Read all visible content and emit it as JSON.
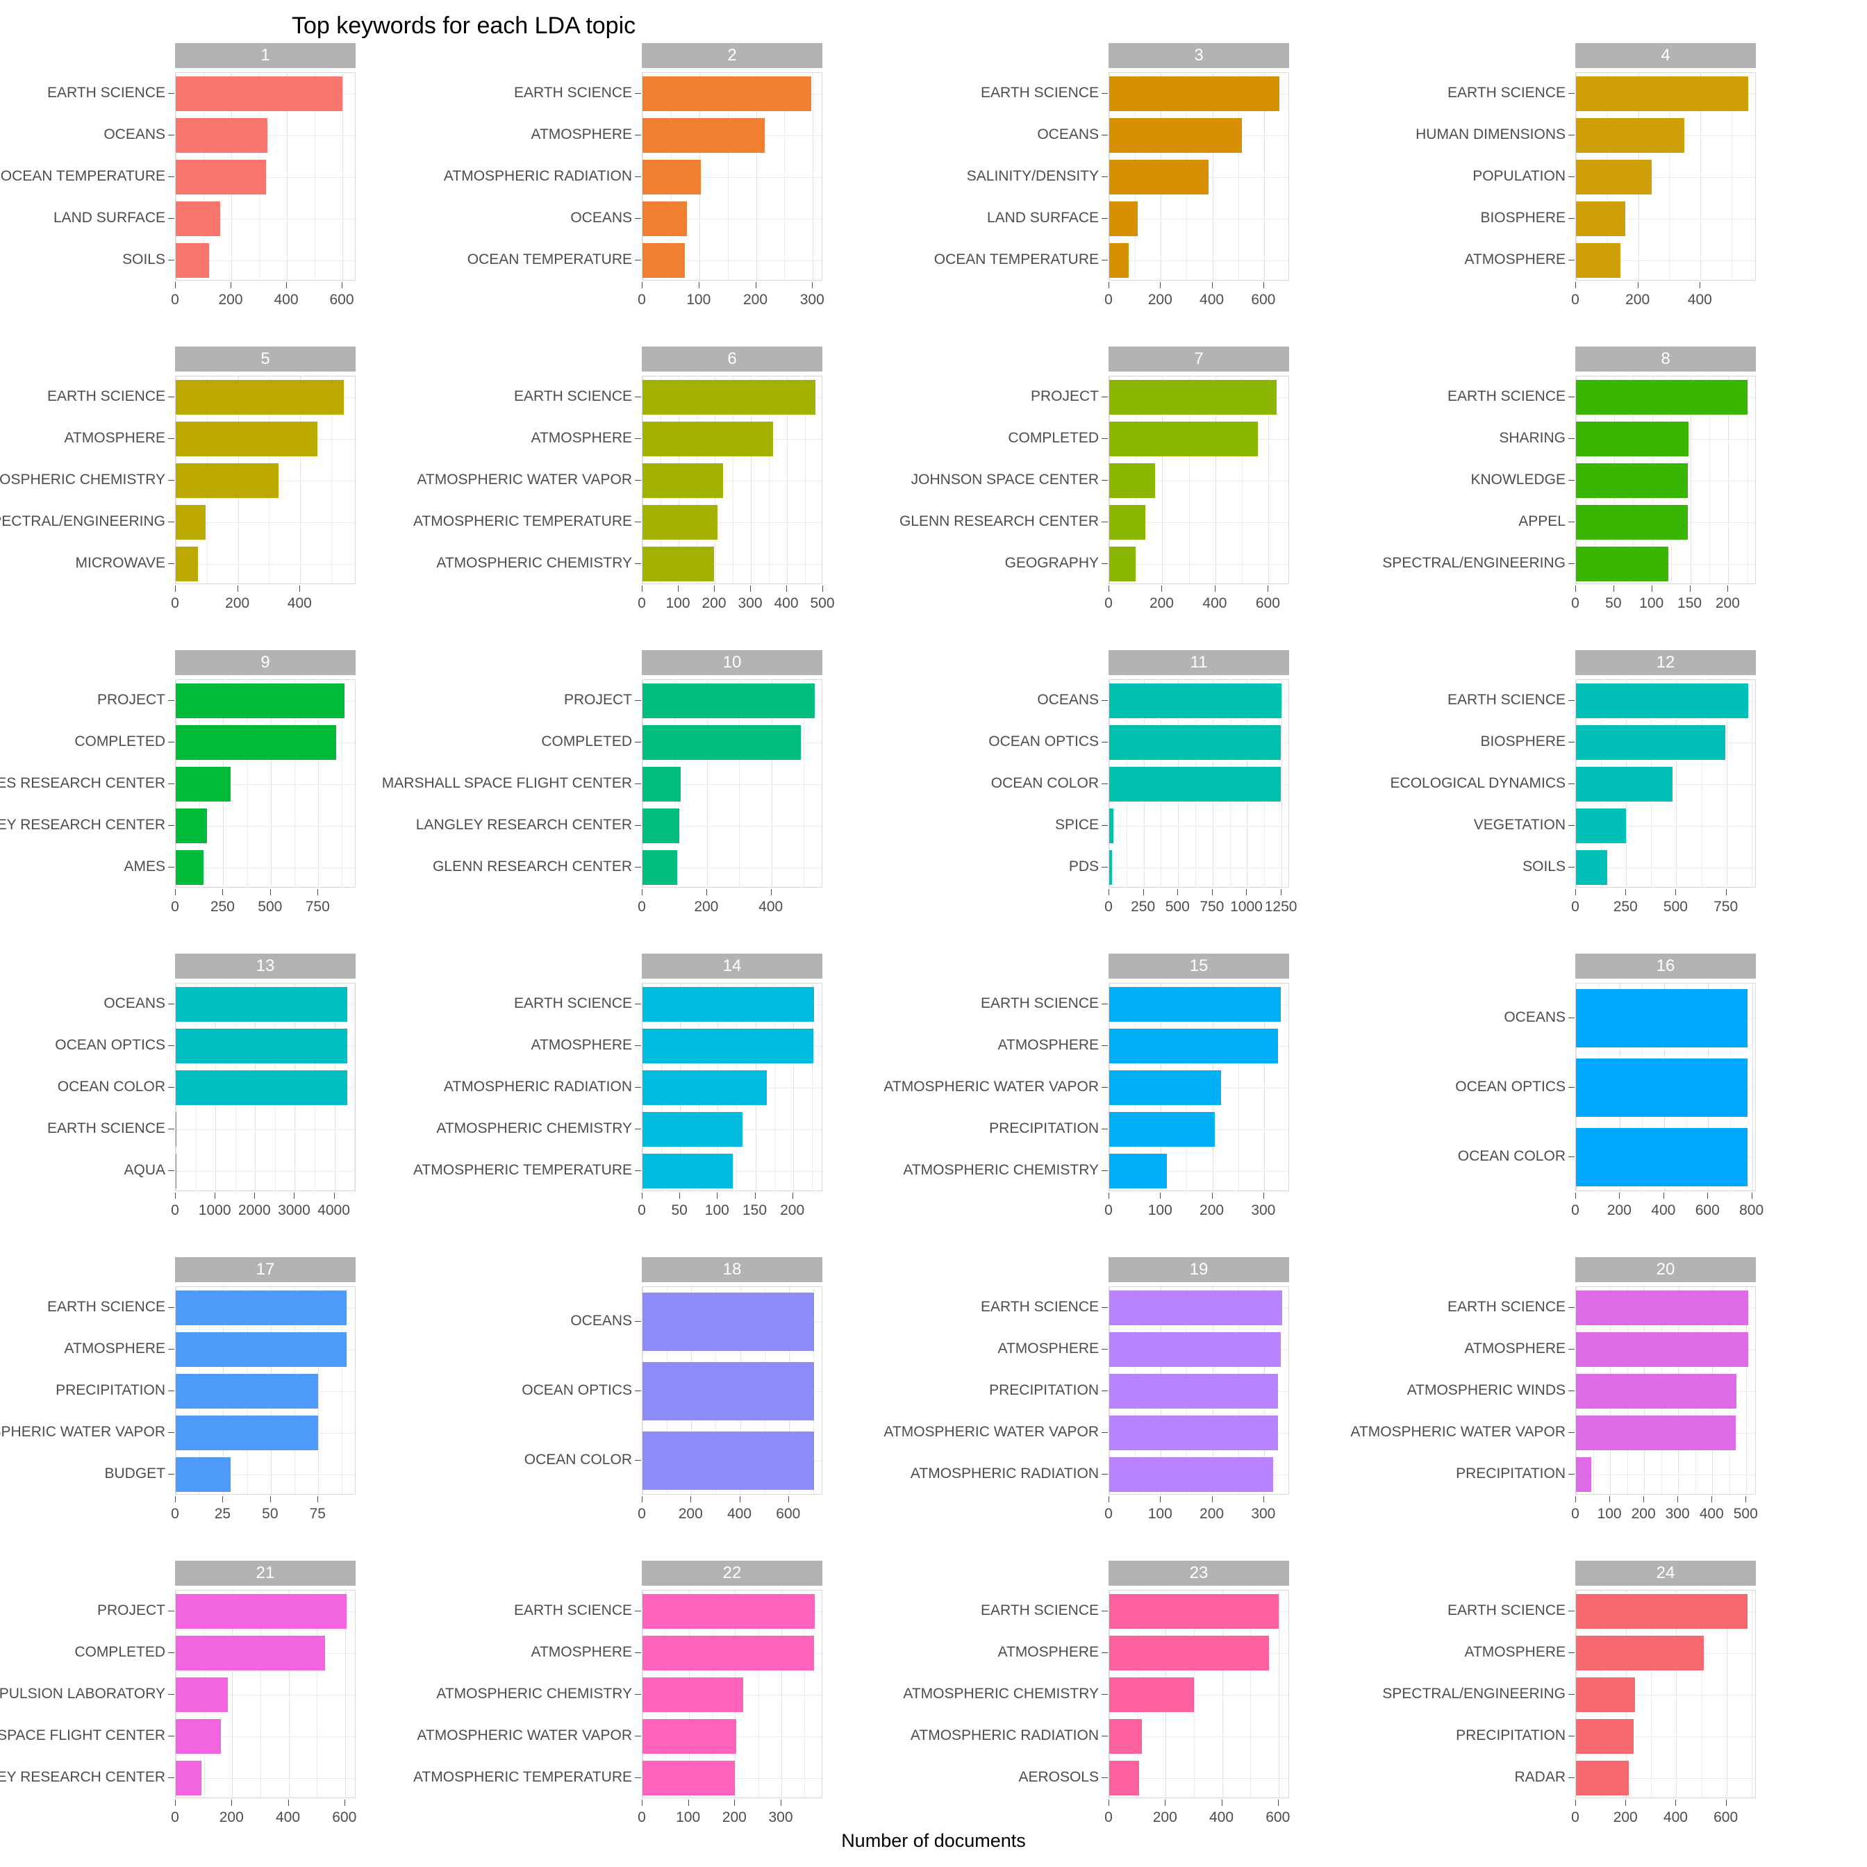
{
  "chart_data": {
    "type": "bar",
    "title": "Top keywords for each LDA topic",
    "xlabel": "Number of documents",
    "ylabel": "",
    "orientation": "horizontal",
    "facet_label_prefix": "",
    "grid": true,
    "legend": "none",
    "strip_background": "#b3b3b3",
    "strip_text_color": "#ffffff",
    "panel_background": "#ffffff",
    "gridline_color": "#ebebeb",
    "panels": [
      {
        "facet": "1",
        "color": "#f8766d",
        "xlim": [
          0,
          650
        ],
        "xticks": [
          0,
          200,
          400,
          600
        ],
        "categories": [
          "EARTH SCIENCE",
          "OCEANS",
          "OCEAN TEMPERATURE",
          "LAND SURFACE",
          "SOILS"
        ],
        "values": [
          600,
          330,
          325,
          160,
          120
        ]
      },
      {
        "facet": "2",
        "color": "#ef7f31",
        "xlim": [
          0,
          318
        ],
        "xticks": [
          0,
          100,
          200,
          300
        ],
        "categories": [
          "EARTH SCIENCE",
          "ATMOSPHERE",
          "ATMOSPHERIC RADIATION",
          "OCEANS",
          "OCEAN TEMPERATURE"
        ],
        "values": [
          297,
          215,
          103,
          78,
          75
        ]
      },
      {
        "facet": "3",
        "color": "#d89000",
        "xlim": [
          0,
          700
        ],
        "xticks": [
          0,
          200,
          400,
          600
        ],
        "categories": [
          "EARTH SCIENCE",
          "OCEANS",
          "SALINITY/DENSITY",
          "LAND SURFACE",
          "OCEAN TEMPERATURE"
        ],
        "values": [
          660,
          515,
          385,
          110,
          75
        ]
      },
      {
        "facet": "4",
        "color": "#cfa006",
        "xlim": [
          0,
          580
        ],
        "xticks": [
          0,
          200,
          400
        ],
        "categories": [
          "EARTH SCIENCE",
          "HUMAN DIMENSIONS",
          "POPULATION",
          "BIOSPHERE",
          "ATMOSPHERE"
        ],
        "values": [
          553,
          348,
          243,
          158,
          143
        ]
      },
      {
        "facet": "5",
        "color": "#bba900",
        "xlim": [
          0,
          580
        ],
        "xticks": [
          0,
          200,
          400
        ],
        "categories": [
          "EARTH SCIENCE",
          "ATMOSPHERE",
          "ATMOSPHERIC CHEMISTRY",
          "SPECTRAL/ENGINEERING",
          "MICROWAVE"
        ],
        "values": [
          540,
          455,
          330,
          95,
          72
        ]
      },
      {
        "facet": "6",
        "color": "#a3b100",
        "xlim": [
          0,
          500
        ],
        "xticks": [
          0,
          100,
          200,
          300,
          400,
          500
        ],
        "categories": [
          "EARTH SCIENCE",
          "ATMOSPHERE",
          "ATMOSPHERIC WATER VAPOR",
          "ATMOSPHERIC TEMPERATURE",
          "ATMOSPHERIC CHEMISTRY"
        ],
        "values": [
          478,
          362,
          224,
          208,
          198
        ]
      },
      {
        "facet": "7",
        "color": "#8cb700",
        "xlim": [
          0,
          680
        ],
        "xticks": [
          0,
          200,
          400,
          600
        ],
        "categories": [
          "PROJECT",
          "COMPLETED",
          "JOHNSON SPACE CENTER",
          "GLENN RESEARCH CENTER",
          "GEOGRAPHY"
        ],
        "values": [
          631,
          560,
          172,
          135,
          100
        ]
      },
      {
        "facet": "8",
        "color": "#39b600",
        "xlim": [
          0,
          237
        ],
        "xticks": [
          0,
          50,
          100,
          150,
          200
        ],
        "categories": [
          "EARTH SCIENCE",
          "SHARING",
          "KNOWLEDGE",
          "APPEL",
          "SPECTRAL/ENGINEERING"
        ],
        "values": [
          225,
          148,
          147,
          147,
          121
        ]
      },
      {
        "facet": "9",
        "color": "#00bb38",
        "xlim": [
          0,
          950
        ],
        "xticks": [
          0,
          250,
          500,
          750
        ],
        "categories": [
          "PROJECT",
          "COMPLETED",
          "AMES RESEARCH CENTER",
          "LANGLEY RESEARCH CENTER",
          "AMES"
        ],
        "values": [
          888,
          845,
          290,
          165,
          145
        ]
      },
      {
        "facet": "10",
        "color": "#00bf7d",
        "xlim": [
          0,
          560
        ],
        "xticks": [
          0,
          200,
          400
        ],
        "categories": [
          "PROJECT",
          "COMPLETED",
          "MARSHALL SPACE FLIGHT CENTER",
          "LANGLEY RESEARCH CENTER",
          "GLENN RESEARCH CENTER"
        ],
        "values": [
          535,
          490,
          118,
          115,
          108
        ]
      },
      {
        "facet": "11",
        "color": "#00c0af",
        "xlim": [
          0,
          1310
        ],
        "xticks": [
          0,
          250,
          500,
          750,
          1000,
          1250
        ],
        "categories": [
          "OCEANS",
          "OCEAN OPTICS",
          "OCEAN COLOR",
          "SPICE",
          "PDS"
        ],
        "values": [
          1248,
          1246,
          1244,
          30,
          22
        ]
      },
      {
        "facet": "12",
        "color": "#00c0b8",
        "xlim": [
          0,
          900
        ],
        "xticks": [
          0,
          250,
          500,
          750
        ],
        "categories": [
          "EARTH SCIENCE",
          "BIOSPHERE",
          "ECOLOGICAL DYNAMICS",
          "VEGETATION",
          "SOILS"
        ],
        "values": [
          858,
          745,
          480,
          250,
          155
        ]
      },
      {
        "facet": "13",
        "color": "#00bfc4",
        "xlim": [
          0,
          4550
        ],
        "xticks": [
          0,
          1000,
          2000,
          3000,
          4000
        ],
        "categories": [
          "OCEANS",
          "OCEAN OPTICS",
          "OCEAN COLOR",
          "EARTH SCIENCE",
          "AQUA"
        ],
        "values": [
          4320,
          4320,
          4320,
          4,
          3
        ]
      },
      {
        "facet": "14",
        "color": "#00bde0",
        "xlim": [
          0,
          240
        ],
        "xticks": [
          0,
          50,
          100,
          150,
          200
        ],
        "categories": [
          "EARTH SCIENCE",
          "ATMOSPHERE",
          "ATMOSPHERIC RADIATION",
          "ATMOSPHERIC CHEMISTRY",
          "ATMOSPHERIC TEMPERATURE"
        ],
        "values": [
          228,
          227,
          165,
          133,
          120
        ]
      },
      {
        "facet": "15",
        "color": "#00b0f6",
        "xlim": [
          0,
          350
        ],
        "xticks": [
          0,
          100,
          200,
          300
        ],
        "categories": [
          "EARTH SCIENCE",
          "ATMOSPHERE",
          "ATMOSPHERIC WATER VAPOR",
          "PRECIPITATION",
          "ATMOSPHERIC CHEMISTRY"
        ],
        "values": [
          332,
          327,
          217,
          205,
          112
        ]
      },
      {
        "facet": "16",
        "color": "#00a9ff",
        "xlim": [
          0,
          820
        ],
        "xticks": [
          0,
          200,
          400,
          600,
          800
        ],
        "categories": [
          "OCEANS",
          "OCEAN OPTICS",
          "OCEAN COLOR"
        ],
        "values": [
          780,
          780,
          780
        ]
      },
      {
        "facet": "17",
        "color": "#4f9bfb",
        "xlim": [
          0,
          95
        ],
        "xticks": [
          0,
          25,
          50,
          75
        ],
        "categories": [
          "EARTH SCIENCE",
          "ATMOSPHERE",
          "PRECIPITATION",
          "ATMOSPHERIC WATER VAPOR",
          "BUDGET"
        ],
        "values": [
          90,
          90,
          75,
          75,
          29
        ]
      },
      {
        "facet": "18",
        "color": "#8b8bf9",
        "xlim": [
          0,
          740
        ],
        "xticks": [
          0,
          200,
          400,
          600
        ],
        "categories": [
          "OCEANS",
          "OCEAN OPTICS",
          "OCEAN COLOR"
        ],
        "values": [
          702,
          702,
          702
        ]
      },
      {
        "facet": "19",
        "color": "#b983ff",
        "xlim": [
          0,
          350
        ],
        "xticks": [
          0,
          100,
          200,
          300
        ],
        "categories": [
          "EARTH SCIENCE",
          "ATMOSPHERE",
          "PRECIPITATION",
          "ATMOSPHERIC WATER VAPOR",
          "ATMOSPHERIC RADIATION"
        ],
        "values": [
          335,
          332,
          327,
          327,
          318
        ]
      },
      {
        "facet": "20",
        "color": "#de6ae8",
        "xlim": [
          0,
          530
        ],
        "xticks": [
          0,
          100,
          200,
          300,
          400,
          500
        ],
        "categories": [
          "EARTH SCIENCE",
          "ATMOSPHERE",
          "ATMOSPHERIC WINDS",
          "ATMOSPHERIC WATER VAPOR",
          "PRECIPITATION"
        ],
        "values": [
          505,
          505,
          470,
          468,
          45
        ]
      },
      {
        "facet": "21",
        "color": "#f365e0",
        "xlim": [
          0,
          640
        ],
        "xticks": [
          0,
          200,
          400,
          600
        ],
        "categories": [
          "PROJECT",
          "COMPLETED",
          "JET PROPULSION LABORATORY",
          "GODDARD SPACE FLIGHT CENTER",
          "LANGLEY RESEARCH CENTER"
        ],
        "values": [
          605,
          530,
          185,
          160,
          90
        ]
      },
      {
        "facet": "22",
        "color": "#ff62bc",
        "xlim": [
          0,
          390
        ],
        "xticks": [
          0,
          100,
          200,
          300
        ],
        "categories": [
          "EARTH SCIENCE",
          "ATMOSPHERE",
          "ATMOSPHERIC CHEMISTRY",
          "ATMOSPHERIC WATER VAPOR",
          "ATMOSPHERIC TEMPERATURE"
        ],
        "values": [
          372,
          370,
          218,
          203,
          200
        ]
      },
      {
        "facet": "23",
        "color": "#fd61a0",
        "xlim": [
          0,
          640
        ],
        "xticks": [
          0,
          200,
          400,
          600
        ],
        "categories": [
          "EARTH SCIENCE",
          "ATMOSPHERE",
          "ATMOSPHERIC CHEMISTRY",
          "ATMOSPHERIC RADIATION",
          "AEROSOLS"
        ],
        "values": [
          600,
          565,
          300,
          115,
          105
        ]
      },
      {
        "facet": "24",
        "color": "#f8696e",
        "xlim": [
          0,
          720
        ],
        "xticks": [
          0,
          200,
          400,
          600
        ],
        "categories": [
          "EARTH SCIENCE",
          "ATMOSPHERE",
          "SPECTRAL/ENGINEERING",
          "PRECIPITATION",
          "RADAR"
        ],
        "values": [
          685,
          510,
          235,
          230,
          210
        ]
      }
    ]
  }
}
